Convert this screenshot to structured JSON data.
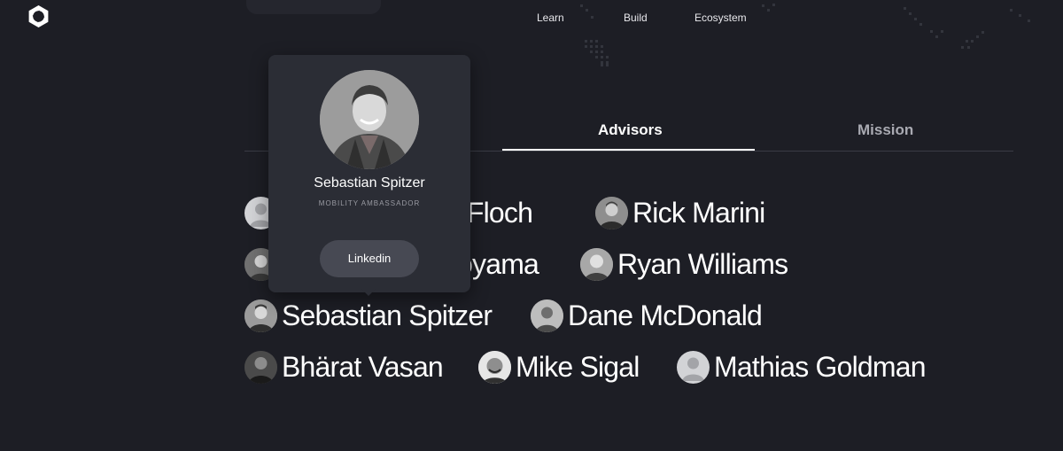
{
  "nav": {
    "items": [
      "Learn",
      "Build",
      "Ecosystem"
    ]
  },
  "tabs": {
    "advisors": "Advisors",
    "mission": "Mission",
    "active": "Advisors"
  },
  "advisors": [
    {
      "name": "n-Floch",
      "avatar": "placeholder"
    },
    {
      "name": "Rick Marini",
      "avatar": "photo"
    },
    {
      "name": "oyama",
      "avatar": "photo"
    },
    {
      "name": "Ryan Williams",
      "avatar": "photo"
    },
    {
      "name": "Sebastian Spitzer",
      "avatar": "photo"
    },
    {
      "name": "Dane McDonald",
      "avatar": "photo"
    },
    {
      "name": "Bhärat Vasan",
      "avatar": "photo"
    },
    {
      "name": "Mike Sigal",
      "avatar": "photo"
    },
    {
      "name": "Mathias Goldman",
      "avatar": "placeholder"
    }
  ],
  "popup": {
    "name": "Sebastian Spitzer",
    "role": "MOBILITY AMBASSADOR",
    "button": "Linkedin"
  },
  "colors": {
    "background": "#1d1e25",
    "popup": "#2b2d35",
    "button": "#474953",
    "tab_inactive": "#a9aab2"
  }
}
